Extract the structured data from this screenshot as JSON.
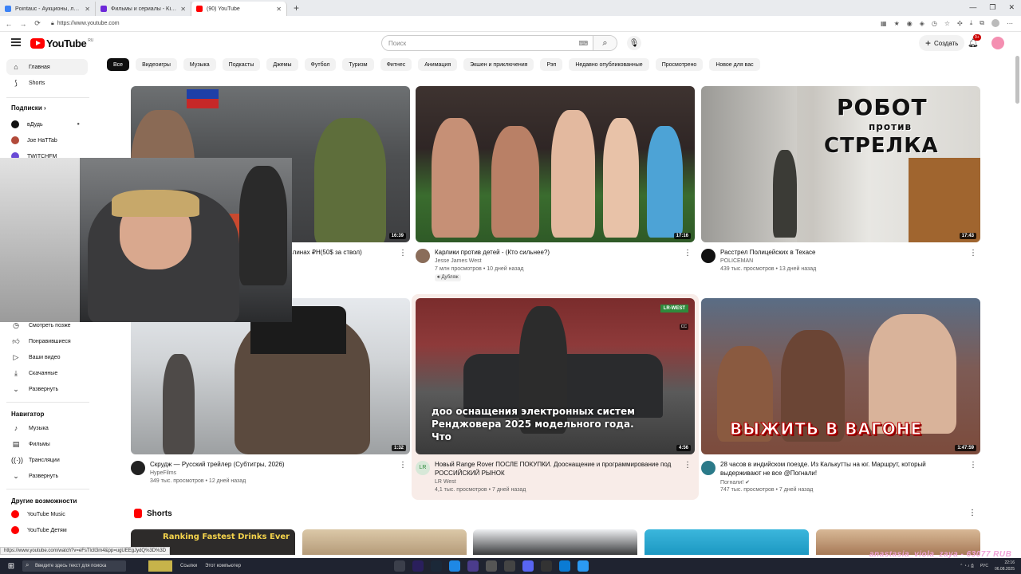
{
  "browser": {
    "tabs": [
      {
        "title": "Pointauc - Аукционы, лотереи и ...",
        "color": "#3b82f6"
      },
      {
        "title": "Фильмы и сериалы - Kinobox.in",
        "color": "#6d28d9"
      },
      {
        "title": "(90) YouTube",
        "color": "#ff0000",
        "active": true
      }
    ],
    "url": "https://www.youtube.com",
    "window_controls": [
      "—",
      "❐",
      "✕"
    ]
  },
  "header": {
    "logo_text": "YouTube",
    "logo_region": "RU",
    "search_placeholder": "Поиск",
    "create_label": "Создать",
    "notifications_badge": "9+"
  },
  "sidebar": {
    "main": [
      {
        "label": "Главная",
        "icon": "home-icon",
        "active": true
      },
      {
        "label": "Shorts",
        "icon": "shorts-icon"
      }
    ],
    "subscriptions_title": "Подписки",
    "subscriptions": [
      {
        "label": "вДудь",
        "color": "#111111"
      },
      {
        "label": "Joe HaTTab",
        "color": "#b24a3a"
      },
      {
        "label": "TWITCHFM",
        "color": "#6a4bd6"
      }
    ],
    "you": [
      {
        "label": "Смотреть позже",
        "icon": "clock-icon"
      },
      {
        "label": "Понравившиеся",
        "icon": "thumb-up-icon"
      },
      {
        "label": "Ваши видео",
        "icon": "play-square-icon"
      },
      {
        "label": "Скачанные",
        "icon": "download-icon"
      },
      {
        "label": "Развернуть",
        "icon": "chevron-down-icon"
      }
    ],
    "navigator_title": "Навигатор",
    "navigator": [
      {
        "label": "Музыка",
        "icon": "music-icon"
      },
      {
        "label": "Фильмы",
        "icon": "film-icon"
      },
      {
        "label": "Трансляции",
        "icon": "live-icon"
      },
      {
        "label": "Развернуть",
        "icon": "chevron-down-icon"
      }
    ],
    "more_title": "Другие возможности",
    "more": [
      {
        "label": "YouTube Music",
        "color": "#ff0000"
      },
      {
        "label": "YouTube Детям",
        "color": "#ff0000"
      }
    ]
  },
  "chips": [
    "Все",
    "Видеоигры",
    "Музыка",
    "Подкасты",
    "Джемы",
    "Футбол",
    "Туризм",
    "Фитнес",
    "Анимация",
    "Экшен и приключения",
    "Рэп",
    "Недавно опубликованные",
    "Просмотрено",
    "Новое для вас"
  ],
  "videos": [
    {
      "title": "...линах ₽Н(50$ за ствол)",
      "channel": "",
      "stats": "",
      "duration": "16:39"
    },
    {
      "title": "Карлики против детей - (Кто сильнее?)",
      "channel": "Jesse James West",
      "stats": "7 млн просмотров • 10 дней назад",
      "duration": "17:16",
      "badge": "Дубляж"
    },
    {
      "title": "Расстрел Полицейских в Техасе",
      "channel": "POLICEMAN",
      "stats": "439 тыс. просмотров • 13 дней назад",
      "duration": "17:43",
      "thumb_text_1": "РОБОТ",
      "thumb_text_2": "против",
      "thumb_text_3": "СТРЕЛКА"
    },
    {
      "title": "Скрудж — Русский трейлер (Субтитры, 2026)",
      "channel": "HypeFilms",
      "stats": "349 тыс. просмотров • 12 дней назад",
      "duration": "1:32"
    },
    {
      "title": "Новый Range Rover ПОСЛЕ ПОКУПКИ. Дооснащение и программирование под РОССИЙСКИЙ РЫНОК",
      "channel": "LR West",
      "stats": "4,1 тыс. просмотров • 7 дней назад",
      "duration": "4:56",
      "caption": "доо оснащения электронных систем Ренджовера 2025 модельного года. Что",
      "logo": "LR-WEST"
    },
    {
      "title": "28 часов в индийском поезде. Из Калькутты на юг. Маршрут, который выдерживают не все @Погнали!",
      "channel": "Погнали!",
      "stats": "747 тыс. просмотров • 7 дней назад",
      "duration": "1:47:59",
      "thumb_text": "ВЫЖИТЬ В ВАГОНЕ"
    }
  ],
  "shorts": {
    "title": "Shorts",
    "first_text": "Ranking Fastest Drinks Ever"
  },
  "status_url": "https://www.youtube.com/watch?v=eFsTlclt3m4&pp=ugUEEgJydQ%3D%3D",
  "watermark": "anastasia_viola_zaya - 63077 RUB",
  "taskbar": {
    "search_placeholder": "Введите здесь текст для поиска",
    "links_label": "Ссылки",
    "computer_label": "Этот компьютер",
    "lang": "РУС",
    "time": "22:16",
    "date": "06.08.2025"
  }
}
